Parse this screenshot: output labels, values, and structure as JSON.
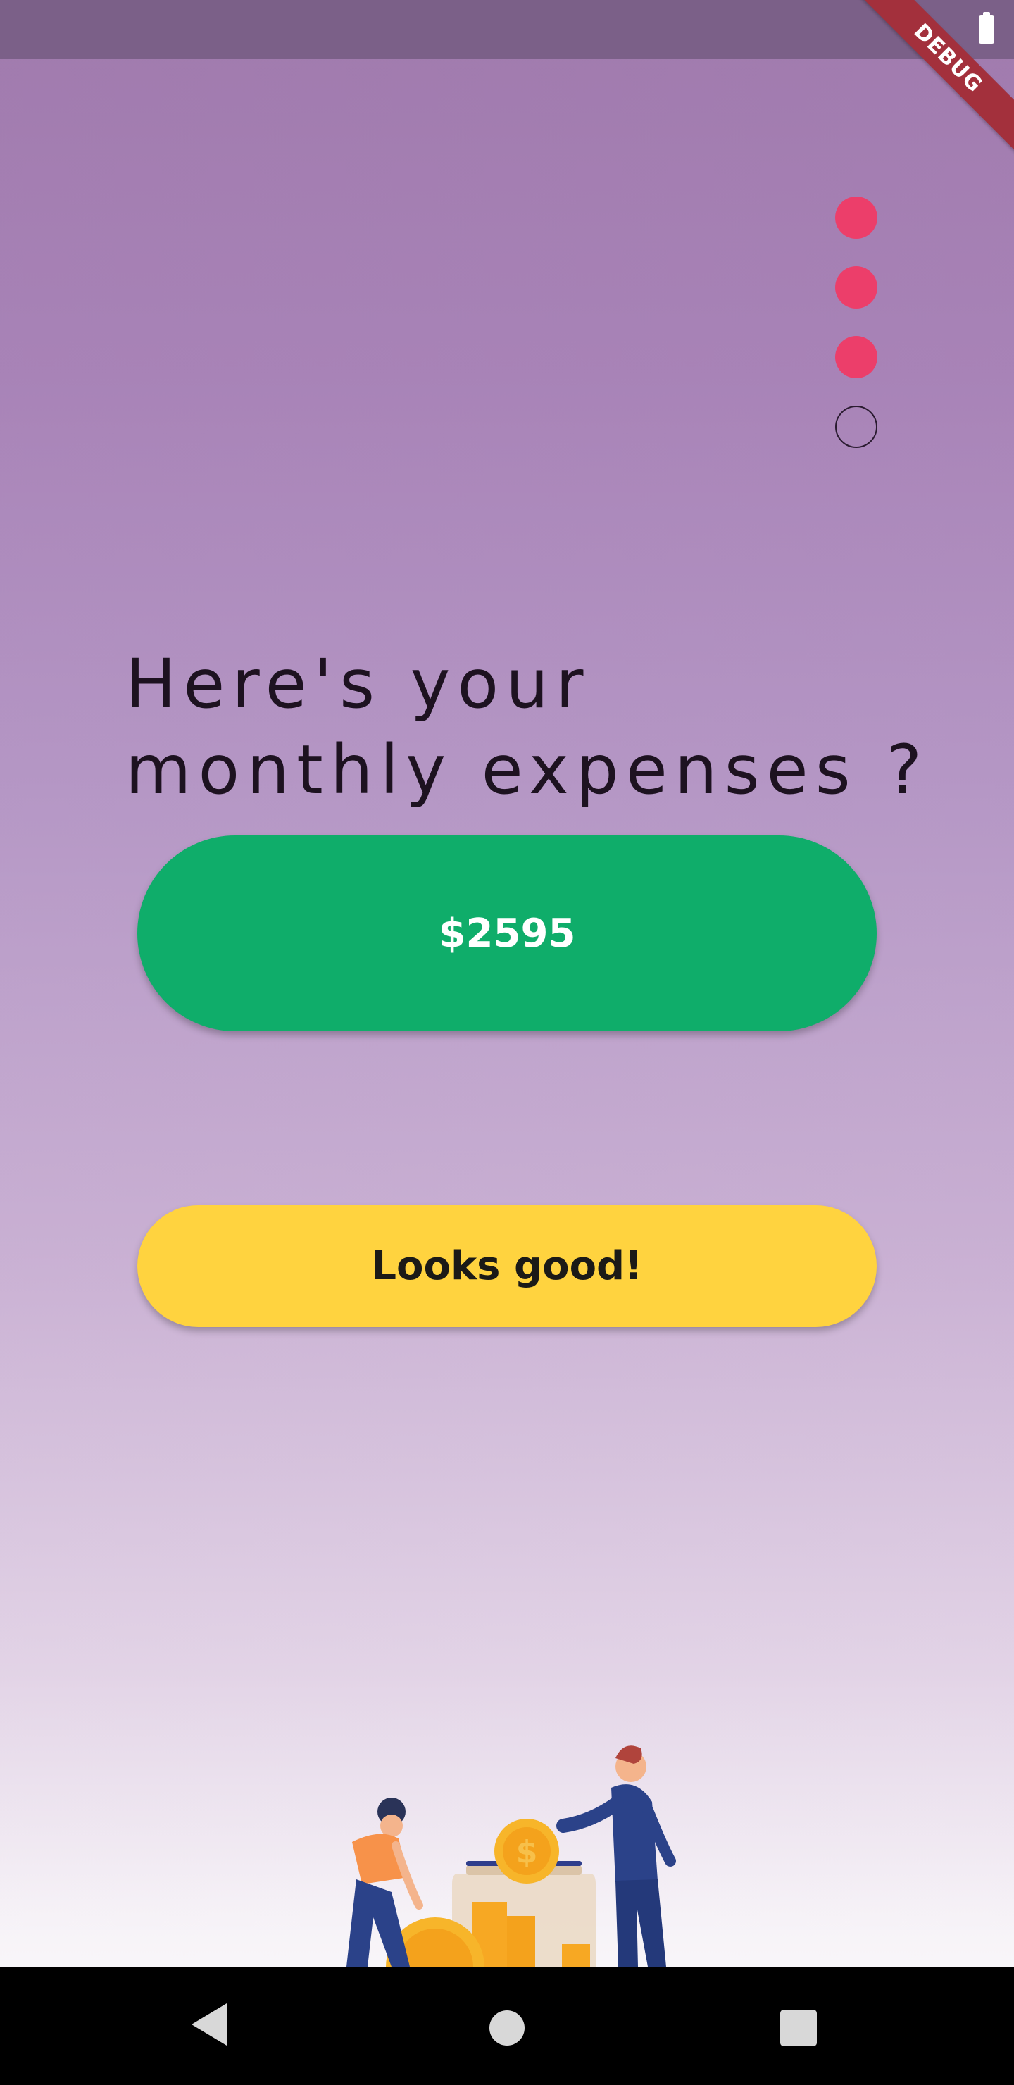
{
  "status_bar": {
    "battery_icon": "battery-full-icon"
  },
  "debug_banner": {
    "label": "DEBUG"
  },
  "progress": {
    "total_steps": 4,
    "completed_steps": 3,
    "filled_color": "#ec3e6a"
  },
  "question": {
    "text": "Here's your monthly expenses ?"
  },
  "amount": {
    "value": "$2595",
    "color": "#0fad6a"
  },
  "confirm": {
    "label": "Looks good!",
    "color": "#ffd33f"
  },
  "illustration": {
    "description_icon": "saving-coins-jar-icon"
  },
  "nav_bar": {
    "back_icon": "back-triangle-icon",
    "home_icon": "home-circle-icon",
    "recent_icon": "recent-square-icon"
  }
}
